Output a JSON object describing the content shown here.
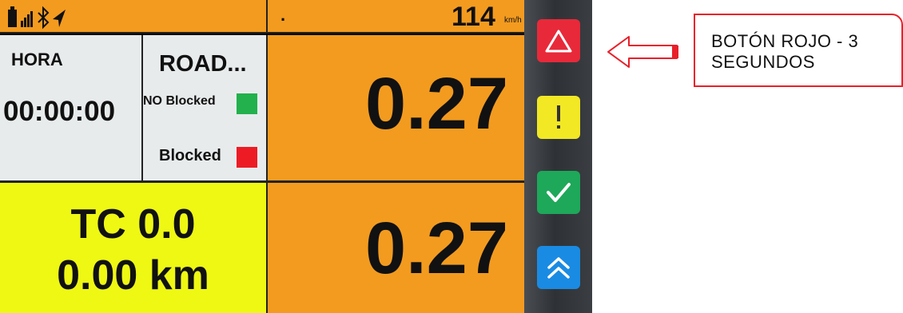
{
  "status": {
    "speed_value": "114",
    "speed_unit": "km/h",
    "gps_dot": "."
  },
  "hora": {
    "label": "HORA",
    "time": "00:00:00"
  },
  "road": {
    "title": "ROAD...",
    "no_blocked_label": "NO Blocked",
    "blocked_label": "Blocked",
    "no_blocked_color": "#22b14c",
    "blocked_color": "#ed1c24"
  },
  "distance": {
    "top_value": "0.27",
    "bottom_value": "0.27"
  },
  "tc": {
    "line1": "TC 0.0",
    "line2": "0.00 km"
  },
  "device_buttons": [
    {
      "name": "red-warning-button",
      "icon": "triangle-icon",
      "color": "#e8293a"
    },
    {
      "name": "yellow-alert-button",
      "icon": "exclamation-icon",
      "color": "#f2e824"
    },
    {
      "name": "green-confirm-button",
      "icon": "check-icon",
      "color": "#1ea85a"
    },
    {
      "name": "blue-up-button",
      "icon": "double-chevron-up-icon",
      "color": "#1a8be3"
    }
  ],
  "annotation": {
    "line1": "BOTÓN ROJO - 3",
    "line2": "SEGUNDOS",
    "color": "#e8202a"
  }
}
